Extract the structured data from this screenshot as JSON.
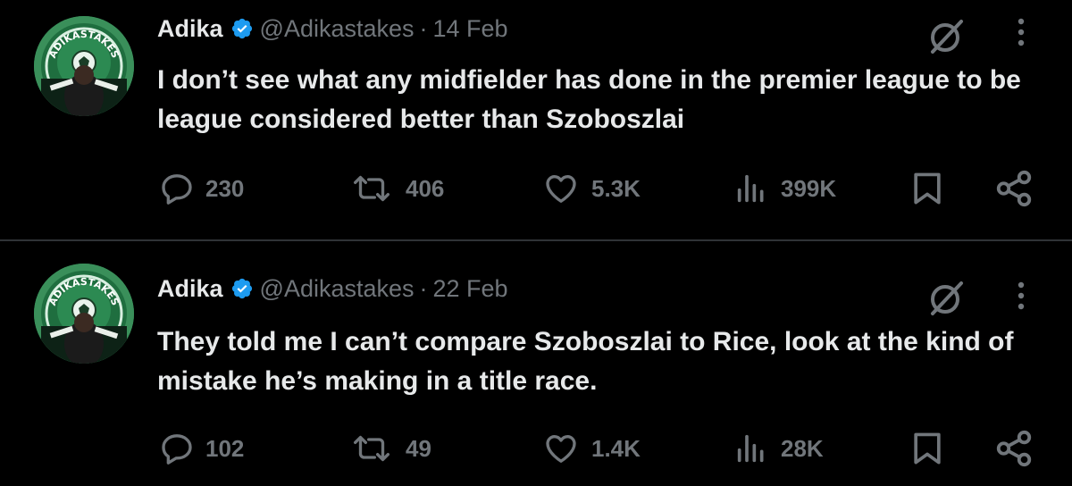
{
  "tweets": [
    {
      "author": "Adika",
      "handle": "@Adikastakes",
      "separator": "·",
      "date": "14 Feb",
      "text": "I don’t see what any midfielder has done in the premier league to be league considered better than Szoboszlai",
      "stats": {
        "replies": "230",
        "reposts": "406",
        "likes": "5.3K",
        "views": "399K"
      }
    },
    {
      "author": "Adika",
      "handle": "@Adikastakes",
      "separator": "·",
      "date": "22 Feb",
      "text": "They told me I can’t compare Szoboszlai to Rice, look at the kind of mistake he’s making in a title race.",
      "stats": {
        "replies": "102",
        "reposts": "49",
        "likes": "1.4K",
        "views": "28K"
      }
    }
  ],
  "avatar": {
    "logo_text": "ADIKASTAKES"
  },
  "icons": {
    "verified": "verified-badge-icon",
    "grok": "grok-icon",
    "more": "more-icon",
    "reply": "reply-icon",
    "repost": "repost-icon",
    "like": "like-icon",
    "views": "views-icon",
    "bookmark": "bookmark-icon",
    "share": "share-icon"
  },
  "colors": {
    "background": "#000000",
    "text": "#e7e9ea",
    "secondary": "#71767b",
    "verified": "#1d9bf0",
    "divider": "#2f3336"
  }
}
